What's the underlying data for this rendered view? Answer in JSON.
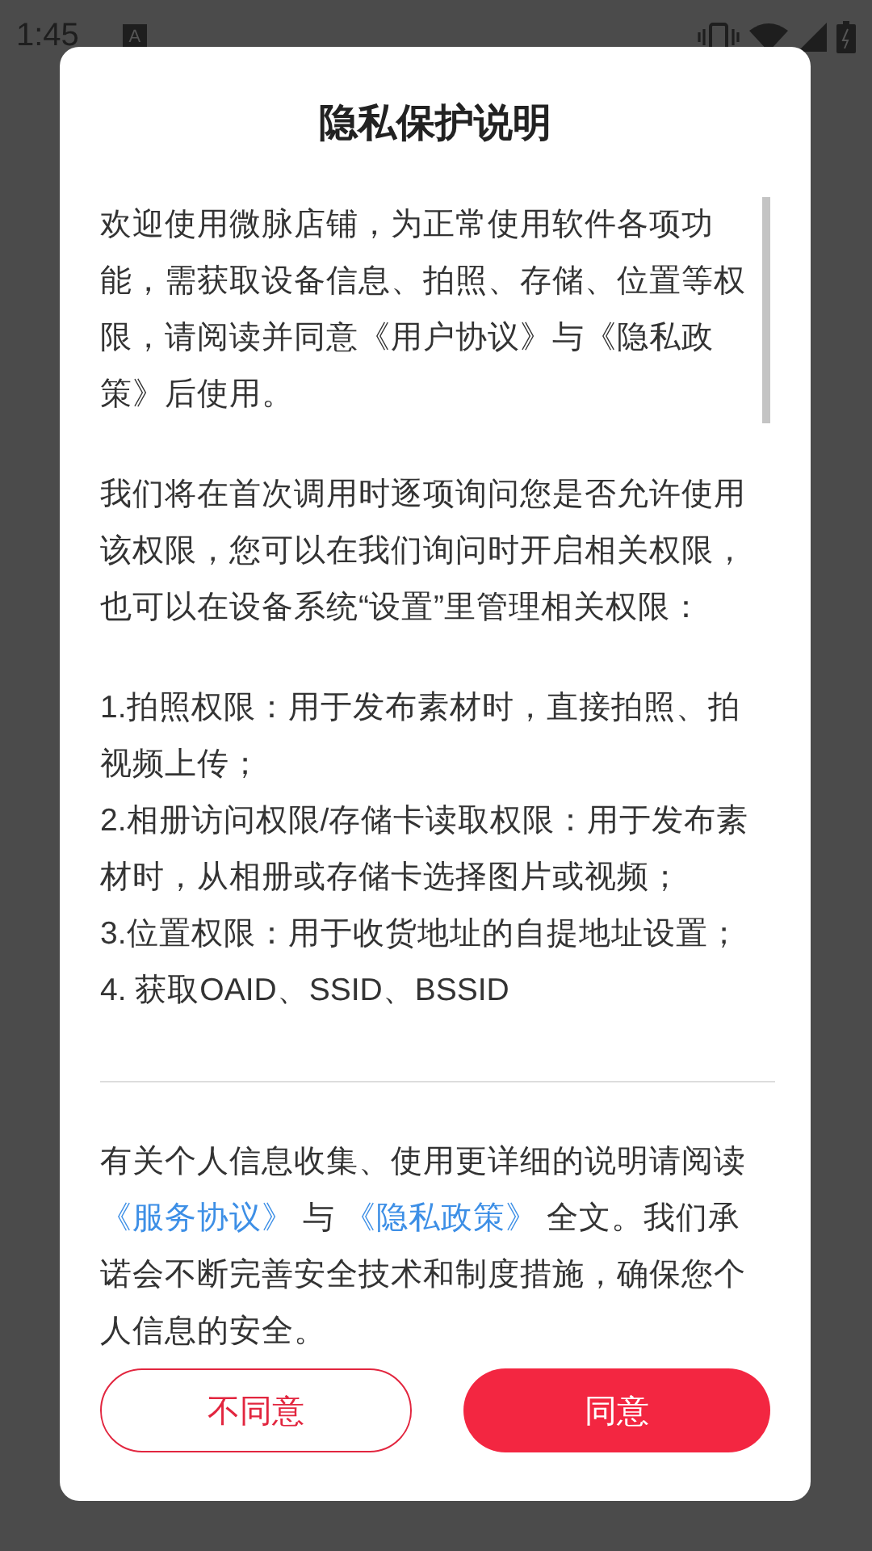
{
  "status_bar": {
    "time": "1:45",
    "notification": "A"
  },
  "dialog": {
    "title": "隐私保护说明",
    "paragraphs": [
      "欢迎使用微脉店铺，为正常使用软件各项功能，需获取设备信息、拍照、存储、位置等权限，请阅读并同意《用户协议》与《隐私政策》后使用。",
      "我们将在首次调用时逐项询问您是否允许使用该权限，您可以在我们询问时开启相关权限，也可以在设备系统“设置”里管理相关权限："
    ],
    "permissions": [
      "1.拍照权限：用于发布素材时，直接拍照、拍视频上传；",
      "2.相册访问权限/存储卡读取权限：用于发布素材时，从相册或存储卡选择图片或视频；",
      "3.位置权限：用于收货地址的自提地址设置；",
      "4. 获取OAID、SSID、BSSID"
    ],
    "footer": [
      {
        "kind": "text",
        "text": "有关个人信息收集、使用更详细的说明请阅读 "
      },
      {
        "kind": "link",
        "text": "《服务协议》"
      },
      {
        "kind": "text",
        "text": " 与 "
      },
      {
        "kind": "link",
        "text": "《隐私政策》"
      },
      {
        "kind": "text",
        "text": " 全文。我们承诺会不断完善安全技术和制度措施，确保您个人信息的安全。"
      }
    ],
    "buttons": [
      {
        "label": "不同意",
        "kind": "outline"
      },
      {
        "label": "同意",
        "kind": "filled"
      }
    ]
  }
}
